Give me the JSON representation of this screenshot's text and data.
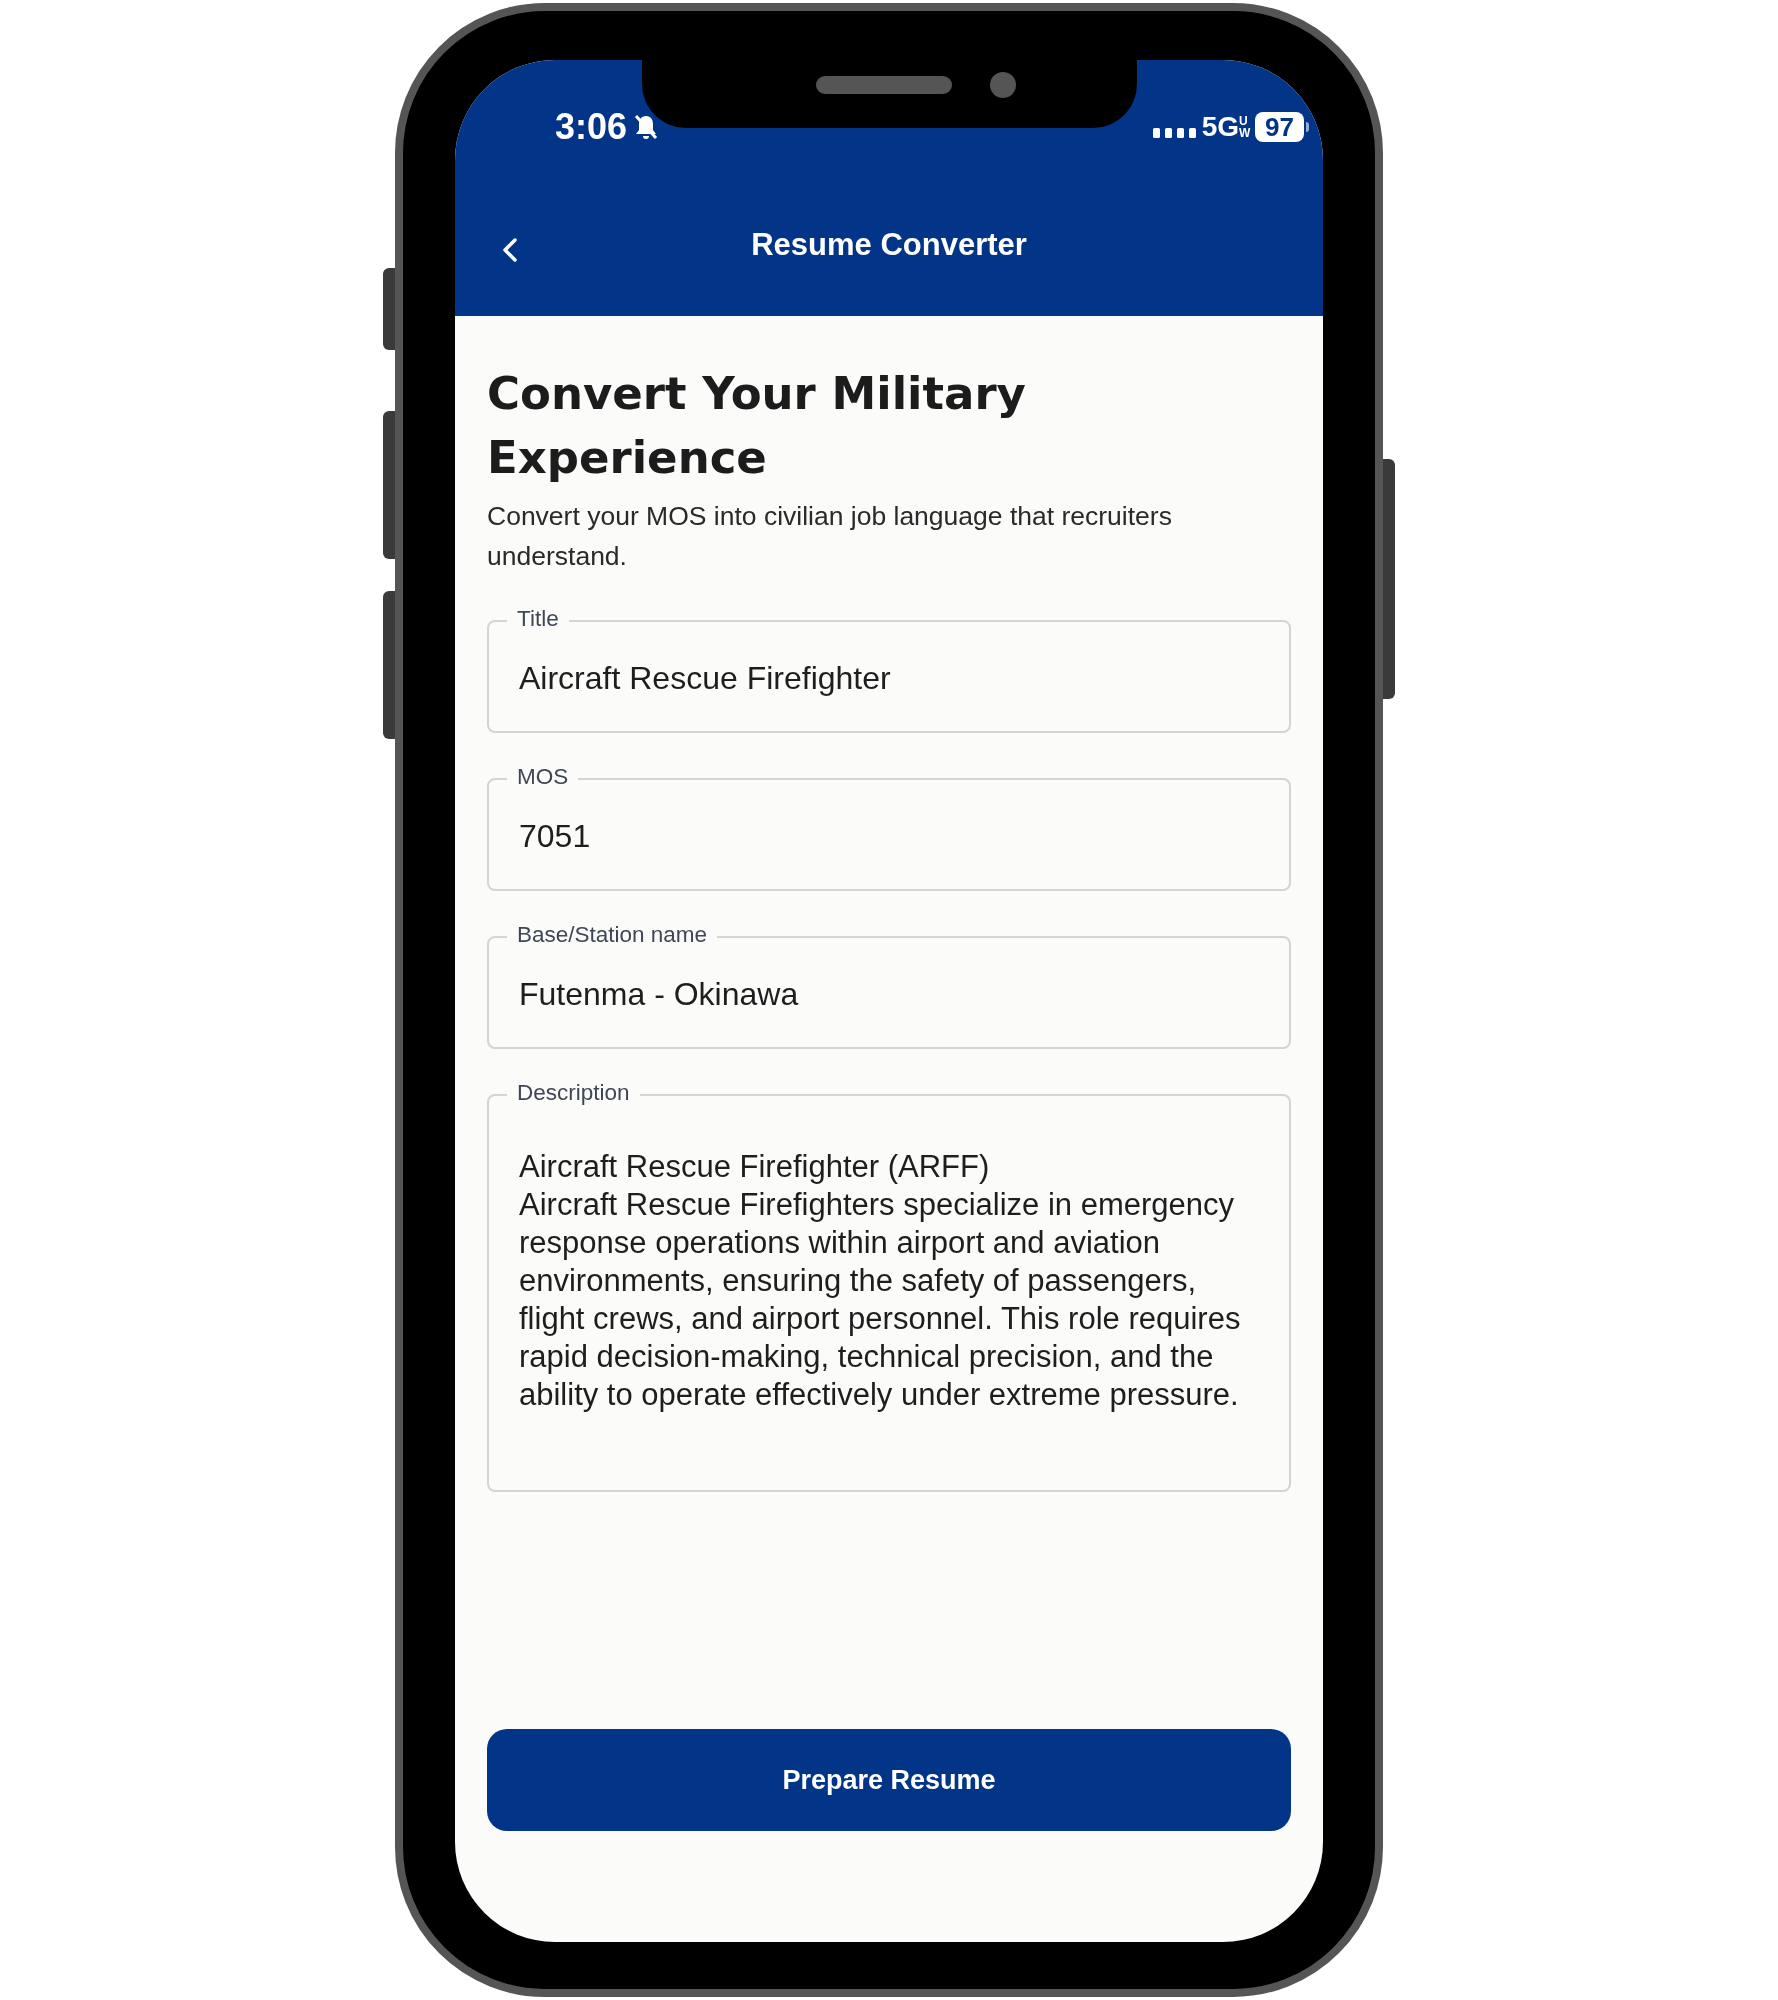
{
  "status_bar": {
    "time": "3:06",
    "network": "5G",
    "network_badge": "UW",
    "battery": "97"
  },
  "header": {
    "title": "Resume Converter"
  },
  "page": {
    "heading": "Convert Your Military Experience",
    "subtitle": "Convert your MOS into civilian job language that recruiters understand."
  },
  "fields": [
    {
      "label": "Title",
      "value": "Aircraft Rescue Firefighter",
      "kind": "input"
    },
    {
      "label": "MOS",
      "value": "7051",
      "kind": "input"
    },
    {
      "label": "Base/Station name",
      "value": "Futenma - Okinawa",
      "kind": "input"
    },
    {
      "label": "Description",
      "value": "Aircraft Rescue Firefighter (ARFF)\nAircraft Rescue Firefighters specialize in emergency response operations within airport and aviation environments, ensuring the safety of passengers, flight crews, and airport personnel. This role requires rapid decision-making, technical precision, and the ability to operate effectively under extreme pressure.",
      "kind": "textarea"
    }
  ],
  "button": {
    "label": "Prepare Resume"
  }
}
